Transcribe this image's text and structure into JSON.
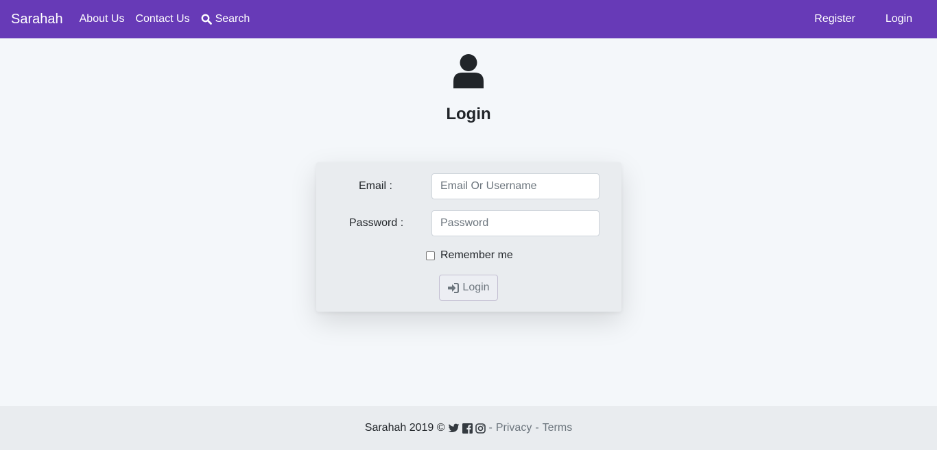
{
  "navbar": {
    "brand": "Sarahah",
    "links": {
      "about": "About Us",
      "contact": "Contact Us",
      "search": "Search"
    },
    "right": {
      "register": "Register",
      "login": "Login"
    }
  },
  "page": {
    "title": "Login"
  },
  "form": {
    "email_label": "Email :",
    "email_placeholder": "Email Or Username",
    "email_value": "",
    "password_label": "Password :",
    "password_placeholder": "Password",
    "password_value": "",
    "remember_label": "Remember me",
    "remember_checked": false,
    "submit_label": "Login"
  },
  "footer": {
    "copyright": "Sarahah 2019 ©",
    "dash": "-",
    "privacy": "Privacy",
    "terms": "Terms",
    "icons": [
      "twitter-icon",
      "facebook-icon",
      "instagram-icon"
    ]
  },
  "colors": {
    "navbar": "#673ab7",
    "page_bg": "#f4f7fa",
    "footer_bg": "#e9ecef"
  }
}
